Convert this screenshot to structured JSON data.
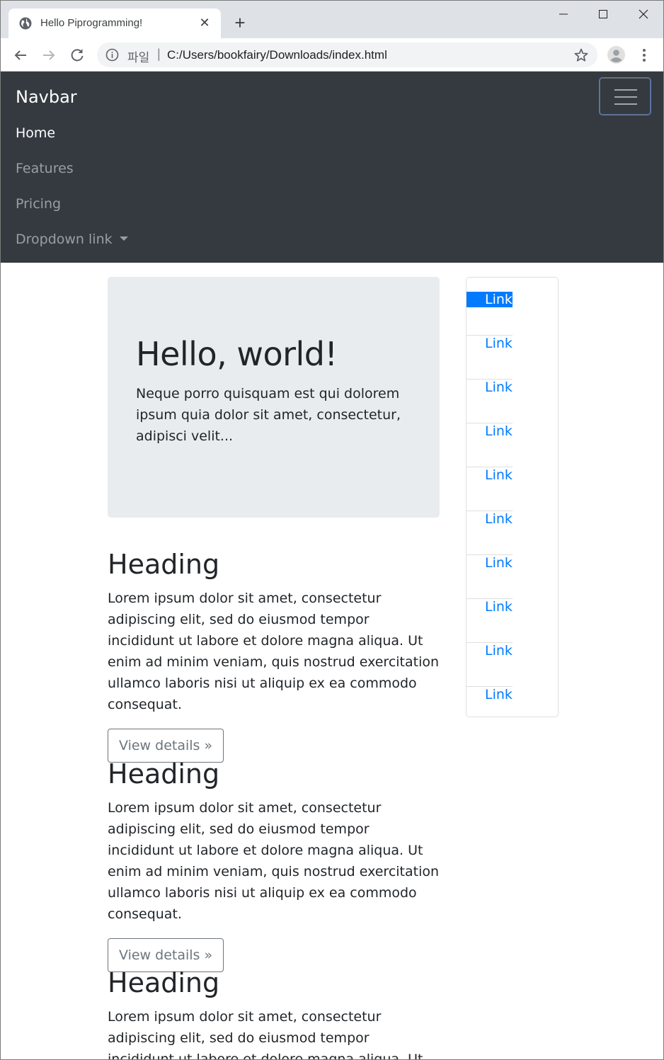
{
  "browser": {
    "tab_title": "Hello Piprogramming!",
    "url_prefix": "파일",
    "url_separator": "|",
    "url": "C:/Users/bookfairy/Downloads/index.html",
    "icons": {
      "favicon": "globe-icon",
      "close_tab": "close-icon",
      "new_tab": "plus-icon",
      "back": "arrow-left-icon",
      "forward": "arrow-right-icon",
      "reload": "reload-icon",
      "site_info": "info-icon",
      "bookmark": "star-icon",
      "profile": "account-icon",
      "menu": "kebab-menu-icon",
      "minimize": "minimize-icon",
      "maximize": "maximize-icon",
      "close_window": "close-icon"
    }
  },
  "navbar": {
    "brand": "Navbar",
    "toggler_icon": "hamburger-icon",
    "links": [
      {
        "label": "Home",
        "active": true
      },
      {
        "label": "Features",
        "active": false
      },
      {
        "label": "Pricing",
        "active": false
      },
      {
        "label": "Dropdown link",
        "active": false,
        "dropdown": true
      }
    ]
  },
  "jumbotron": {
    "title": "Hello, world!",
    "text": "Neque porro quisquam est qui dolorem ipsum quia dolor sit amet, consectetur, adipisci velit..."
  },
  "sections": [
    {
      "heading": "Heading",
      "text": "Lorem ipsum dolor sit amet, consectetur adipiscing elit, sed do eiusmod tempor incididunt ut labore et dolore magna aliqua. Ut enim ad minim veniam, quis nostrud exercitation ullamco laboris nisi ut aliquip ex ea commodo consequat.",
      "button": "View details »"
    },
    {
      "heading": "Heading",
      "text": "Lorem ipsum dolor sit amet, consectetur adipiscing elit, sed do eiusmod tempor incididunt ut labore et dolore magna aliqua. Ut enim ad minim veniam, quis nostrud exercitation ullamco laboris nisi ut aliquip ex ea commodo consequat.",
      "button": "View details »"
    },
    {
      "heading": "Heading",
      "text": "Lorem ipsum dolor sit amet, consectetur adipiscing elit, sed do eiusmod tempor incididunt ut labore et dolore magna aliqua. Ut enim ad minim veniam, quis"
    }
  ],
  "list_group": [
    {
      "label": "Link",
      "active": true
    },
    {
      "label": "Link",
      "active": false
    },
    {
      "label": "Link",
      "active": false
    },
    {
      "label": "Link",
      "active": false
    },
    {
      "label": "Link",
      "active": false
    },
    {
      "label": "Link",
      "active": false
    },
    {
      "label": "Link",
      "active": false
    },
    {
      "label": "Link",
      "active": false
    },
    {
      "label": "Link",
      "active": false
    },
    {
      "label": "Link",
      "active": false
    }
  ],
  "colors": {
    "navbar_bg": "#343a40",
    "primary": "#007bff",
    "jumbotron_bg": "#e9ecef",
    "secondary": "#6c757d"
  }
}
